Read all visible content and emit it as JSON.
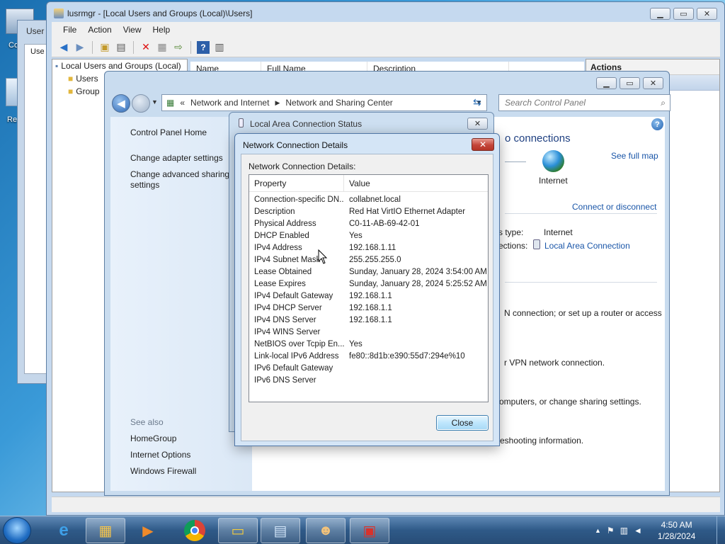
{
  "desktop": {
    "labels": [
      "Co",
      "Re"
    ]
  },
  "background_window": {
    "title": "User",
    "tab": "Use"
  },
  "lusrmgr": {
    "title": "lusrmgr - [Local Users and Groups (Local)\\Users]",
    "menu": [
      "File",
      "Action",
      "View",
      "Help"
    ],
    "tree": {
      "root": "Local Users and Groups (Local)",
      "children": [
        "Users",
        "Group"
      ]
    },
    "columns": [
      "Name",
      "Full Name",
      "Description"
    ],
    "actions_title": "Actions"
  },
  "nsc": {
    "breadcrumb_prefix": "«",
    "breadcrumb": [
      "Network and Internet",
      "Network and Sharing Center"
    ],
    "search_placeholder": "Search Control Panel",
    "left_links": [
      "Control Panel Home",
      "Change adapter settings",
      "Change advanced sharing settings"
    ],
    "see_also_title": "See also",
    "see_also": [
      "HomeGroup",
      "Internet Options",
      "Windows Firewall"
    ],
    "main": {
      "connections_heading": "o connections",
      "see_full_map": "See full map",
      "internet_label": "Internet",
      "connect_disconnect": "Connect or disconnect",
      "access_type_label": "s type:",
      "access_type_value": "Internet",
      "connections_label": "ections:",
      "connection_link": "Local Area Connection",
      "text1": "N connection; or set up a router or access",
      "text2": "r VPN network connection.",
      "text3": "omputers, or change sharing settings.",
      "text4": "eshooting information."
    }
  },
  "lacs": {
    "title": "Local Area Connection Status"
  },
  "details": {
    "title": "Network Connection Details",
    "label": "Network Connection Details:",
    "col_property": "Property",
    "col_value": "Value",
    "rows": [
      {
        "property": "Connection-specific DN...",
        "value": "collabnet.local"
      },
      {
        "property": "Description",
        "value": "Red Hat VirtIO Ethernet Adapter"
      },
      {
        "property": "Physical Address",
        "value": "C0-11-AB-69-42-01"
      },
      {
        "property": "DHCP Enabled",
        "value": "Yes"
      },
      {
        "property": "IPv4 Address",
        "value": "192.168.1.11"
      },
      {
        "property": "IPv4 Subnet Mask",
        "value": "255.255.255.0"
      },
      {
        "property": "Lease Obtained",
        "value": "Sunday, January 28, 2024 3:54:00 AM"
      },
      {
        "property": "Lease Expires",
        "value": "Sunday, January 28, 2024 5:25:52 AM"
      },
      {
        "property": "IPv4 Default Gateway",
        "value": "192.168.1.1"
      },
      {
        "property": "IPv4 DHCP Server",
        "value": "192.168.1.1"
      },
      {
        "property": "IPv4 DNS Server",
        "value": "192.168.1.1"
      },
      {
        "property": "IPv4 WINS Server",
        "value": ""
      },
      {
        "property": "NetBIOS over Tcpip En...",
        "value": "Yes"
      },
      {
        "property": "Link-local IPv6 Address",
        "value": "fe80::8d1b:e390:55d7:294e%10"
      },
      {
        "property": "IPv6 Default Gateway",
        "value": ""
      },
      {
        "property": "IPv6 DNS Server",
        "value": ""
      }
    ],
    "close_button": "Close"
  },
  "taskbar": {
    "time": "4:50 AM",
    "date": "1/28/2024"
  }
}
